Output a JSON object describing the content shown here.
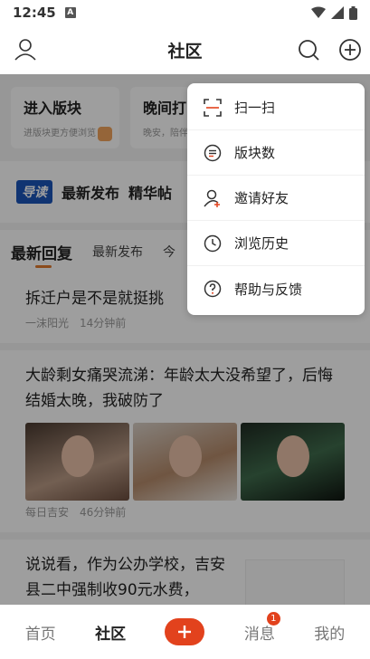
{
  "statusbar": {
    "time": "12:45",
    "sim": "A"
  },
  "header": {
    "title": "社区",
    "avatar_icon": "person-icon",
    "search_icon": "search-icon",
    "plus_icon": "plus-circle-icon"
  },
  "cards": [
    {
      "title": "进入版块",
      "subtitle": "进版块更方便浏览"
    },
    {
      "title": "晚间打",
      "subtitle": "晚安，陪伴"
    }
  ],
  "guide": {
    "tag": "导读",
    "items": [
      "最新发布",
      "精华帖"
    ]
  },
  "tabs": {
    "items": [
      "最新回复",
      "最新发布",
      "今"
    ],
    "active": 0
  },
  "posts": [
    {
      "title": "拆迁户是不是就挺挑",
      "author": "一沫阳光",
      "time": "14分钟前"
    },
    {
      "title": "大龄剩女痛哭流涕：年龄太大没希望了，后悔结婚太晚，我破防了",
      "author": "每日吉安",
      "time": "46分钟前"
    },
    {
      "title": "说说看，作为公办学校，吉安县二中强制收90元水费，"
    }
  ],
  "menu": {
    "items": [
      {
        "label": "扫一扫",
        "icon": "scan-icon"
      },
      {
        "label": "版块数",
        "icon": "list-icon"
      },
      {
        "label": "邀请好友",
        "icon": "add-person-icon"
      },
      {
        "label": "浏览历史",
        "icon": "clock-icon"
      },
      {
        "label": "帮助与反馈",
        "icon": "help-icon"
      }
    ]
  },
  "bottomnav": {
    "items": [
      "首页",
      "社区",
      "消息",
      "我的"
    ],
    "active": "社区",
    "message_badge": "1"
  },
  "colors": {
    "accent": "#e2421d",
    "tab_underline": "#e07a2e",
    "guide_tag": "#1a55b8"
  }
}
